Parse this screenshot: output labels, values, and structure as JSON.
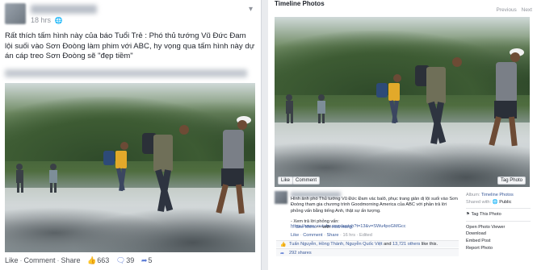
{
  "left_post": {
    "time": "18 hrs",
    "privacy_icon": "globe-icon",
    "text": "Rất thích tấm hình này của báo Tuổi Trẻ : Phó thủ tướng Vũ Đức Đam lội suối vào Sơn Đoòng làm phim với ABC, hy vọng qua tấm hình này dự án cáp treo Sơn Đoòng sẽ \"đẹp tiềm\"",
    "actions": {
      "like": "Like",
      "comment": "Comment",
      "share": "Share",
      "sep": "·",
      "like_count": "663",
      "comment_count": "39",
      "share_count": "5"
    }
  },
  "viewer": {
    "title": "Timeline Photos",
    "previous": "Previous",
    "next": "Next",
    "like_btn": "Like",
    "comment_btn": "Comment",
    "tag_btn": "Tag Photo",
    "description": "Hình ảnh phó Thủ tướng Vũ Đức Đam vác balô, phục trang giản dị lội suối vào Sơn Đoòng tham gia chương trình Goodmorning America của ABC với phần trả lời phỏng vấn bằng tiếng Anh, thật sự ấn tượng.",
    "link_label": "- Xem trả lời phỏng vấn:",
    "link_url": "https://www.youtube.com/watch?t=13&v=SWu4poGMGcc",
    "see_more": "... See More",
    "with_label": "— with",
    "with_name": "Hoa Hang.",
    "meta": {
      "like": "Like",
      "comment": "Comment",
      "share": "Share",
      "time": "16 hrs",
      "edited": "Edited",
      "sep": "·"
    },
    "likes_text": "Tuấn Nguyễn, Hồng Thành, Nguyễn Quốc Việt",
    "likes_and": "and",
    "likes_others": "13,721 others",
    "likes_suffix": "like this.",
    "shares_text": "292 shares",
    "sidebar": {
      "album_label": "Album:",
      "album_value": "Timeline Photos",
      "shared_label": "Shared with:",
      "shared_value": "Public",
      "tag": "Tag This Photo",
      "open_viewer": "Open Photo Viewer",
      "download": "Download",
      "embed": "Embed Post",
      "report": "Report Photo"
    }
  },
  "colors": {
    "link_blue": "#385898",
    "like_blue": "#5b7bd5",
    "meta_gray": "#90949c",
    "panel_bg": "#e9ebee"
  }
}
